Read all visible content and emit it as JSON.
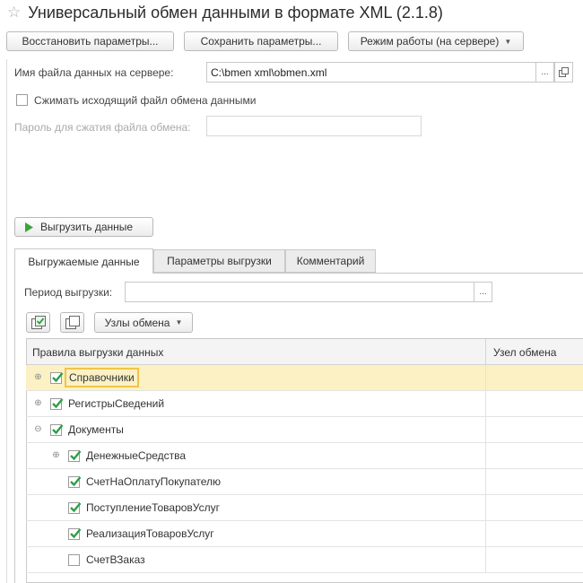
{
  "window": {
    "title": "Универсальный обмен данными в формате XML (2.1.8)"
  },
  "toolbar": {
    "restore_label": "Восстановить параметры...",
    "save_label": "Сохранить параметры...",
    "mode_label": "Режим работы (на сервере)"
  },
  "form": {
    "file_label": "Имя файла данных на сервере:",
    "file_value": "C:\\bmen xml\\obmen.xml",
    "file_btn": "...",
    "compress_label": "Сжимать исходящий файл обмена данными",
    "password_label": "Пароль для сжатия файла обмена:",
    "password_value": ""
  },
  "export_btn": {
    "label": "Выгрузить данные"
  },
  "tabs": [
    {
      "label": "Выгружаемые данные"
    },
    {
      "label": "Параметры выгрузки"
    },
    {
      "label": "Комментарий"
    }
  ],
  "period": {
    "label": "Период выгрузки:",
    "value": "",
    "btn": "..."
  },
  "nodes_btn": {
    "label": "Узлы обмена"
  },
  "grid": {
    "columns": [
      "Правила выгрузки данных",
      "Узел обмена"
    ],
    "rows": [
      {
        "label": "Справочники",
        "checked": true,
        "expander": "⊕",
        "level": 0,
        "selected": true
      },
      {
        "label": "РегистрыСведений",
        "checked": true,
        "expander": "⊕",
        "level": 0
      },
      {
        "label": "Документы",
        "checked": true,
        "expander": "⊖",
        "level": 0
      },
      {
        "label": "ДенежныеСредства",
        "checked": true,
        "expander": "⊕",
        "level": 1
      },
      {
        "label": "СчетНаОплатуПокупателю",
        "checked": true,
        "expander": "",
        "level": 1
      },
      {
        "label": "ПоступлениеТоваровУслуг",
        "checked": true,
        "expander": "",
        "level": 1
      },
      {
        "label": "РеализацияТоваровУслуг",
        "checked": true,
        "expander": "",
        "level": 1
      },
      {
        "label": "СчетВЗаказ",
        "checked": false,
        "expander": "",
        "level": 1
      }
    ]
  },
  "colors": {
    "selected_row": "#fbf1c4",
    "check_green": "#2e9e4a",
    "play_green": "#3aa53a"
  }
}
